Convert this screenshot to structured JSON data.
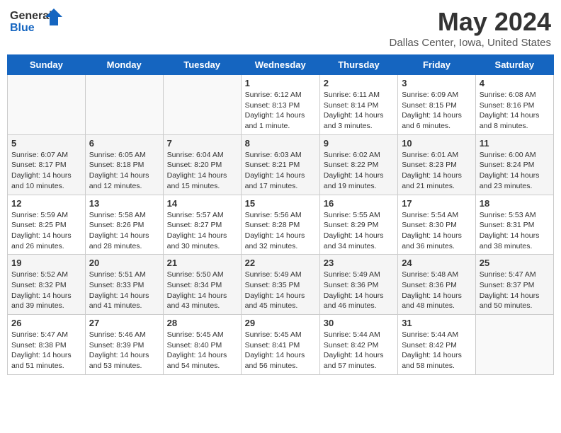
{
  "header": {
    "logo_general": "General",
    "logo_blue": "Blue",
    "month_year": "May 2024",
    "location": "Dallas Center, Iowa, United States"
  },
  "days_of_week": [
    "Sunday",
    "Monday",
    "Tuesday",
    "Wednesday",
    "Thursday",
    "Friday",
    "Saturday"
  ],
  "weeks": [
    [
      {
        "day": "",
        "info": ""
      },
      {
        "day": "",
        "info": ""
      },
      {
        "day": "",
        "info": ""
      },
      {
        "day": "1",
        "info": "Sunrise: 6:12 AM\nSunset: 8:13 PM\nDaylight: 14 hours\nand 1 minute."
      },
      {
        "day": "2",
        "info": "Sunrise: 6:11 AM\nSunset: 8:14 PM\nDaylight: 14 hours\nand 3 minutes."
      },
      {
        "day": "3",
        "info": "Sunrise: 6:09 AM\nSunset: 8:15 PM\nDaylight: 14 hours\nand 6 minutes."
      },
      {
        "day": "4",
        "info": "Sunrise: 6:08 AM\nSunset: 8:16 PM\nDaylight: 14 hours\nand 8 minutes."
      }
    ],
    [
      {
        "day": "5",
        "info": "Sunrise: 6:07 AM\nSunset: 8:17 PM\nDaylight: 14 hours\nand 10 minutes."
      },
      {
        "day": "6",
        "info": "Sunrise: 6:05 AM\nSunset: 8:18 PM\nDaylight: 14 hours\nand 12 minutes."
      },
      {
        "day": "7",
        "info": "Sunrise: 6:04 AM\nSunset: 8:20 PM\nDaylight: 14 hours\nand 15 minutes."
      },
      {
        "day": "8",
        "info": "Sunrise: 6:03 AM\nSunset: 8:21 PM\nDaylight: 14 hours\nand 17 minutes."
      },
      {
        "day": "9",
        "info": "Sunrise: 6:02 AM\nSunset: 8:22 PM\nDaylight: 14 hours\nand 19 minutes."
      },
      {
        "day": "10",
        "info": "Sunrise: 6:01 AM\nSunset: 8:23 PM\nDaylight: 14 hours\nand 21 minutes."
      },
      {
        "day": "11",
        "info": "Sunrise: 6:00 AM\nSunset: 8:24 PM\nDaylight: 14 hours\nand 23 minutes."
      }
    ],
    [
      {
        "day": "12",
        "info": "Sunrise: 5:59 AM\nSunset: 8:25 PM\nDaylight: 14 hours\nand 26 minutes."
      },
      {
        "day": "13",
        "info": "Sunrise: 5:58 AM\nSunset: 8:26 PM\nDaylight: 14 hours\nand 28 minutes."
      },
      {
        "day": "14",
        "info": "Sunrise: 5:57 AM\nSunset: 8:27 PM\nDaylight: 14 hours\nand 30 minutes."
      },
      {
        "day": "15",
        "info": "Sunrise: 5:56 AM\nSunset: 8:28 PM\nDaylight: 14 hours\nand 32 minutes."
      },
      {
        "day": "16",
        "info": "Sunrise: 5:55 AM\nSunset: 8:29 PM\nDaylight: 14 hours\nand 34 minutes."
      },
      {
        "day": "17",
        "info": "Sunrise: 5:54 AM\nSunset: 8:30 PM\nDaylight: 14 hours\nand 36 minutes."
      },
      {
        "day": "18",
        "info": "Sunrise: 5:53 AM\nSunset: 8:31 PM\nDaylight: 14 hours\nand 38 minutes."
      }
    ],
    [
      {
        "day": "19",
        "info": "Sunrise: 5:52 AM\nSunset: 8:32 PM\nDaylight: 14 hours\nand 39 minutes."
      },
      {
        "day": "20",
        "info": "Sunrise: 5:51 AM\nSunset: 8:33 PM\nDaylight: 14 hours\nand 41 minutes."
      },
      {
        "day": "21",
        "info": "Sunrise: 5:50 AM\nSunset: 8:34 PM\nDaylight: 14 hours\nand 43 minutes."
      },
      {
        "day": "22",
        "info": "Sunrise: 5:49 AM\nSunset: 8:35 PM\nDaylight: 14 hours\nand 45 minutes."
      },
      {
        "day": "23",
        "info": "Sunrise: 5:49 AM\nSunset: 8:36 PM\nDaylight: 14 hours\nand 46 minutes."
      },
      {
        "day": "24",
        "info": "Sunrise: 5:48 AM\nSunset: 8:36 PM\nDaylight: 14 hours\nand 48 minutes."
      },
      {
        "day": "25",
        "info": "Sunrise: 5:47 AM\nSunset: 8:37 PM\nDaylight: 14 hours\nand 50 minutes."
      }
    ],
    [
      {
        "day": "26",
        "info": "Sunrise: 5:47 AM\nSunset: 8:38 PM\nDaylight: 14 hours\nand 51 minutes."
      },
      {
        "day": "27",
        "info": "Sunrise: 5:46 AM\nSunset: 8:39 PM\nDaylight: 14 hours\nand 53 minutes."
      },
      {
        "day": "28",
        "info": "Sunrise: 5:45 AM\nSunset: 8:40 PM\nDaylight: 14 hours\nand 54 minutes."
      },
      {
        "day": "29",
        "info": "Sunrise: 5:45 AM\nSunset: 8:41 PM\nDaylight: 14 hours\nand 56 minutes."
      },
      {
        "day": "30",
        "info": "Sunrise: 5:44 AM\nSunset: 8:42 PM\nDaylight: 14 hours\nand 57 minutes."
      },
      {
        "day": "31",
        "info": "Sunrise: 5:44 AM\nSunset: 8:42 PM\nDaylight: 14 hours\nand 58 minutes."
      },
      {
        "day": "",
        "info": ""
      }
    ]
  ]
}
